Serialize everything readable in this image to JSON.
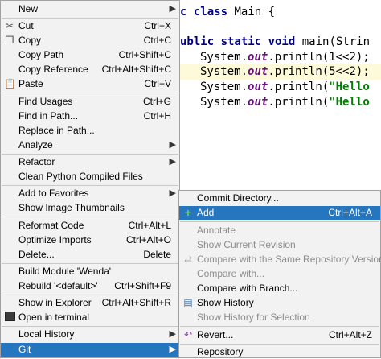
{
  "editor": {
    "lines": [
      {
        "kw": "c class",
        "rest": " Main {"
      },
      {
        "kw": "ublic static void",
        "rest": " main(Strin"
      },
      {
        "pre": "System.",
        "it": "out",
        "mid": ".println(1<<2);"
      },
      {
        "pre": "System.",
        "it": "out",
        "mid": ".println(5<<2);"
      },
      {
        "pre": "System.",
        "it": "out",
        "mid": ".println(",
        "str": "\"Hello"
      },
      {
        "pre": "System.",
        "it": "out",
        "mid": ".println(",
        "str": "\"Hello"
      }
    ]
  },
  "context_menu": {
    "items": [
      {
        "label": "New",
        "shortcut": "",
        "submenu": true,
        "icon": ""
      },
      {
        "label": "Cut",
        "shortcut": "Ctrl+X",
        "icon": "scissors-icon"
      },
      {
        "label": "Copy",
        "shortcut": "Ctrl+C",
        "icon": "copy-icon"
      },
      {
        "label": "Copy Path",
        "shortcut": "Ctrl+Shift+C",
        "icon": ""
      },
      {
        "label": "Copy Reference",
        "shortcut": "Ctrl+Alt+Shift+C",
        "icon": ""
      },
      {
        "label": "Paste",
        "shortcut": "Ctrl+V",
        "icon": "paste-icon"
      },
      {
        "label": "Find Usages",
        "shortcut": "Ctrl+G",
        "icon": ""
      },
      {
        "label": "Find in Path...",
        "shortcut": "Ctrl+H",
        "icon": ""
      },
      {
        "label": "Replace in Path...",
        "shortcut": "",
        "icon": ""
      },
      {
        "label": "Analyze",
        "shortcut": "",
        "submenu": true,
        "icon": ""
      },
      {
        "label": "Refactor",
        "shortcut": "",
        "submenu": true,
        "icon": ""
      },
      {
        "label": "Clean Python Compiled Files",
        "shortcut": "",
        "icon": ""
      },
      {
        "label": "Add to Favorites",
        "shortcut": "",
        "submenu": true,
        "icon": ""
      },
      {
        "label": "Show Image Thumbnails",
        "shortcut": "",
        "icon": ""
      },
      {
        "label": "Reformat Code",
        "shortcut": "Ctrl+Alt+L",
        "icon": ""
      },
      {
        "label": "Optimize Imports",
        "shortcut": "Ctrl+Alt+O",
        "icon": ""
      },
      {
        "label": "Delete...",
        "shortcut": "Delete",
        "icon": ""
      },
      {
        "label": "Build Module 'Wenda'",
        "shortcut": "",
        "icon": ""
      },
      {
        "label": "Rebuild '<default>'",
        "shortcut": "Ctrl+Shift+F9",
        "icon": ""
      },
      {
        "label": "Show in Explorer",
        "shortcut": "Ctrl+Alt+Shift+R",
        "icon": ""
      },
      {
        "label": "Open in terminal",
        "shortcut": "",
        "icon": "terminal-icon"
      },
      {
        "label": "Local History",
        "shortcut": "",
        "submenu": true,
        "icon": ""
      },
      {
        "label": "Git",
        "shortcut": "",
        "submenu": true,
        "icon": ""
      }
    ]
  },
  "git_submenu": {
    "items": [
      {
        "label": "Commit Directory...",
        "shortcut": "",
        "icon": ""
      },
      {
        "label": "Add",
        "shortcut": "Ctrl+Alt+A",
        "icon": "plus-icon"
      },
      {
        "label": "Annotate",
        "shortcut": "",
        "icon": ""
      },
      {
        "label": "Show Current Revision",
        "shortcut": "",
        "icon": ""
      },
      {
        "label": "Compare with the Same Repository Version",
        "shortcut": "",
        "icon": "compare-icon"
      },
      {
        "label": "Compare with...",
        "shortcut": "",
        "icon": ""
      },
      {
        "label": "Compare with Branch...",
        "shortcut": "",
        "icon": ""
      },
      {
        "label": "Show History",
        "shortcut": "",
        "icon": "history-icon"
      },
      {
        "label": "Show History for Selection",
        "shortcut": "",
        "icon": ""
      },
      {
        "label": "Revert...",
        "shortcut": "Ctrl+Alt+Z",
        "icon": "revert-icon"
      },
      {
        "label": "Repository",
        "shortcut": "",
        "icon": ""
      }
    ]
  }
}
